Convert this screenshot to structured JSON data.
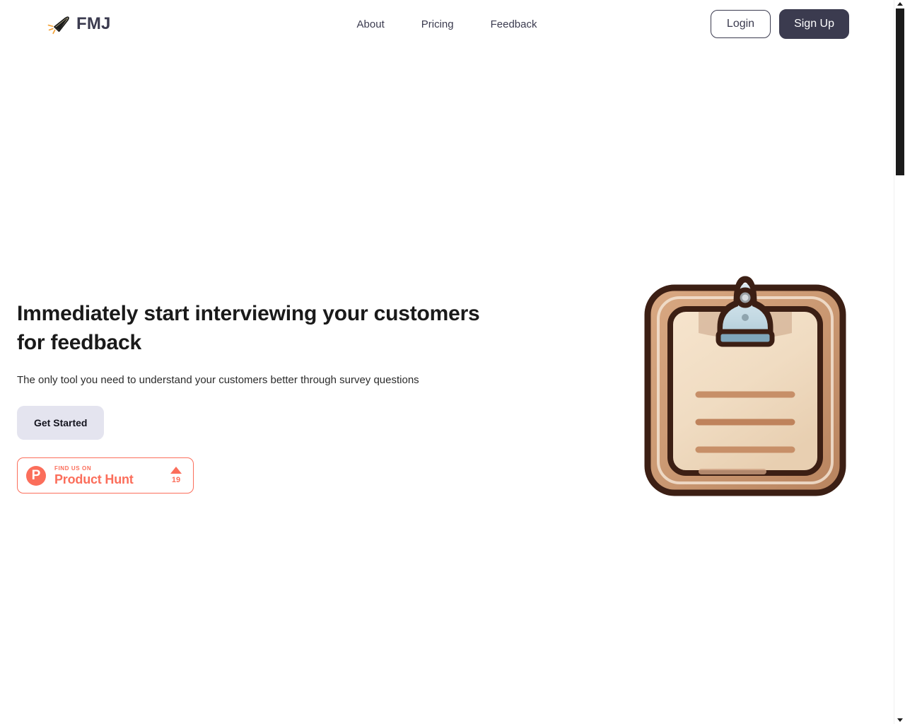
{
  "brand": {
    "name": "FMJ",
    "icon": "bullet-icon",
    "text_color": "#3b3b4f"
  },
  "nav": {
    "items": [
      {
        "label": "About"
      },
      {
        "label": "Pricing"
      },
      {
        "label": "Feedback"
      }
    ]
  },
  "auth": {
    "login_label": "Login",
    "signup_label": "Sign Up",
    "signup_bg": "#3b3b4f"
  },
  "hero": {
    "title": "Immediately start interviewing your customers for feedback",
    "subtitle": "The only tool you need to understand your customers better through survey questions",
    "cta_label": "Get Started",
    "cta_bg": "#e4e4ef",
    "illustration": "clipboard-illustration"
  },
  "product_hunt": {
    "logo_letter": "P",
    "kicker": "FIND US ON",
    "name": "Product Hunt",
    "vote_count": "19",
    "accent_color": "#fb6e5b"
  },
  "scrollbar": {
    "up_icon": "triangle-up-icon",
    "down_icon": "triangle-down-icon",
    "thumb": "scrollbar-thumb"
  }
}
